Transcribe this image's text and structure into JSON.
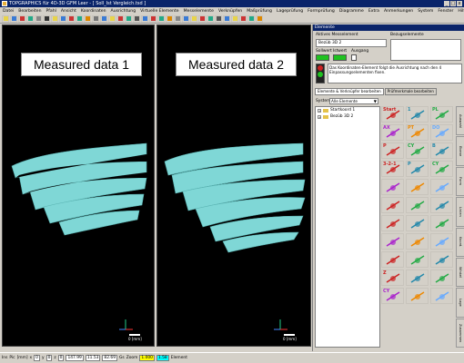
{
  "window": {
    "title": "TOPGRAPHICS für 4D-3D GFM Leer - [ Soll_Ist Vergleich.tsd ]"
  },
  "menu": [
    "Datei",
    "Bearbeiten",
    "Pfahl",
    "Ansicht",
    "Koordinaten",
    "Ausrichtung",
    "Virtuelle Elemente",
    "Messelemente",
    "Verknüpfen",
    "Maßprüfung",
    "Lageprüfung",
    "Formprüfung",
    "Diagramme",
    "Extra",
    "Anmerkungen",
    "System",
    "Fenster",
    "Hilfe"
  ],
  "views": [
    {
      "label": "Measured data 1",
      "scale": "0 [mm]"
    },
    {
      "label": "Measured data 2",
      "scale": "0 [mm]"
    }
  ],
  "panel": {
    "title": "Elemente",
    "active_label": "Aktives Messelement",
    "desc_label": "Bezugselemente",
    "active_value": "Bezüb 3D 2",
    "status_labels": [
      "Sollwert",
      "Istwert",
      "Ausgang"
    ],
    "message": "Das Koordinaten-Element folgt die Ausrichtung nach den 4 Einpassungselementen fixen.",
    "tabs": [
      "Elemente & Verknüpfer bearbeiten",
      "Prüfmerkmale bearbeiten"
    ],
    "system_label": "System",
    "system_value": "Alle Elemente",
    "tree": [
      "Startkoord 1",
      "Bezüb 3D 2"
    ],
    "vtabs": [
      "Auswahl",
      "Ebene",
      "Form",
      "Linien",
      "Koord.",
      "Winkel",
      "Lage",
      "Zusammen"
    ]
  },
  "icons": [
    "Start",
    "1",
    "PL",
    "AX",
    "PT",
    "DO",
    "P",
    "CY",
    "B",
    "3-2-1",
    "P",
    "CY",
    "",
    "",
    "",
    "",
    "",
    "",
    "",
    "",
    "",
    "",
    "",
    "",
    "",
    "",
    "",
    "Z",
    "",
    "",
    "CY",
    "",
    ""
  ],
  "status": {
    "fields": [
      "Ins",
      "Pic",
      "[mm]",
      "x",
      "0",
      "y",
      "0",
      "z",
      "0",
      "147.99",
      "11.53",
      "82.69",
      "Gs",
      "Zoom",
      "1.000",
      "1.58",
      "Element"
    ]
  },
  "colors": {
    "accent": "#0a246a",
    "scan": "#7fd7d6",
    "led_green": "#1fc21f"
  }
}
